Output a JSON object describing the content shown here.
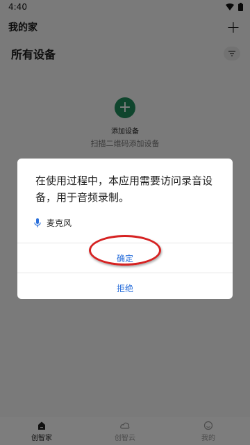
{
  "status_bar": {
    "time": "4:40"
  },
  "header": {
    "title": "我的家"
  },
  "subheader": {
    "title": "所有设备"
  },
  "empty_state": {
    "add_label": "添加设备",
    "hint": "扫描二维码添加设备"
  },
  "bottom_nav": [
    {
      "label": "创智家",
      "active": true
    },
    {
      "label": "创智云",
      "active": false
    },
    {
      "label": "我的",
      "active": false
    }
  ],
  "dialog": {
    "message": "在使用过程中，本应用需要访问录音设备，用于音频录制。",
    "permission": "麦克风",
    "confirm_label": "确定",
    "deny_label": "拒绝"
  },
  "colors": {
    "accent": "#2a6fdb",
    "brand_green": "#1f8a5b",
    "highlight": "#d62222"
  }
}
